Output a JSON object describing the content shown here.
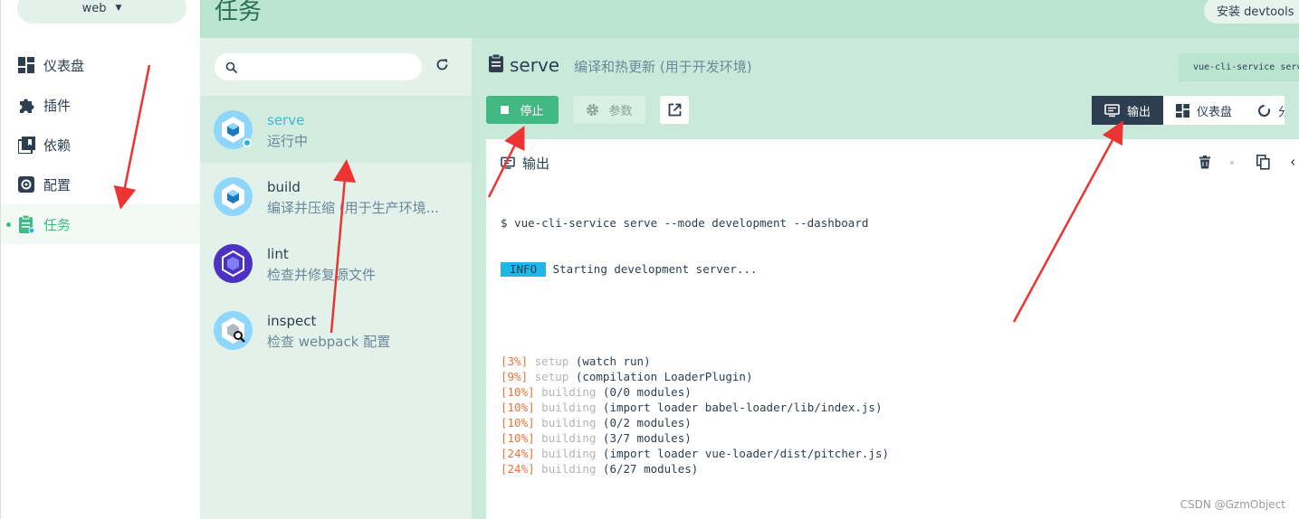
{
  "project": {
    "name": "web"
  },
  "header": {
    "title": "任务",
    "devtools_label": "安装 devtools"
  },
  "sidebar": {
    "items": [
      {
        "label": "仪表盘",
        "icon": "dashboard-icon"
      },
      {
        "label": "插件",
        "icon": "puzzle-icon"
      },
      {
        "label": "依赖",
        "icon": "dependencies-icon"
      },
      {
        "label": "配置",
        "icon": "gear-icon"
      },
      {
        "label": "任务",
        "icon": "clipboard-icon",
        "active": true
      }
    ]
  },
  "tasklist": {
    "search_placeholder": "",
    "tasks": [
      {
        "name": "serve",
        "desc": "运行中",
        "active": true,
        "running": true
      },
      {
        "name": "build",
        "desc": "编译并压缩 (用于生产环境..."
      },
      {
        "name": "lint",
        "desc": "检查并修复源文件"
      },
      {
        "name": "inspect",
        "desc": "检查 webpack 配置"
      }
    ]
  },
  "main": {
    "task_name": "serve",
    "task_desc": "编译和热更新 (用于开发环境)",
    "command": "vue-cli-service serve",
    "stop_label": "停止",
    "params_label": "参数",
    "tabs": [
      {
        "label": "输出",
        "active": true
      },
      {
        "label": "仪表盘"
      },
      {
        "label": "分析"
      }
    ],
    "output_title": "输出"
  },
  "terminal": {
    "command_line": "$ vue-cli-service serve --mode development --dashboard",
    "info_badge": "INFO",
    "info_text": " Starting development server...",
    "lines": [
      {
        "pct": "[3%]",
        "step": "setup",
        "detail": "(watch run)"
      },
      {
        "pct": "[9%]",
        "step": "setup",
        "detail": "(compilation LoaderPlugin)"
      },
      {
        "pct": "[10%]",
        "step": "building",
        "detail": "(0/0 modules)"
      },
      {
        "pct": "[10%]",
        "step": "building",
        "detail": "(import loader babel-loader/lib/index.js)"
      },
      {
        "pct": "[10%]",
        "step": "building",
        "detail": "(0/2 modules)"
      },
      {
        "pct": "[10%]",
        "step": "building",
        "detail": "(3/7 modules)"
      },
      {
        "pct": "[24%]",
        "step": "building",
        "detail": "(import loader vue-loader/dist/pitcher.js)"
      },
      {
        "pct": "[24%]",
        "step": "building",
        "detail": "(6/27 modules)"
      }
    ]
  },
  "watermark": "CSDN @GzmObject",
  "colors": {
    "accent": "#42b983",
    "dark": "#2c3e50",
    "info": "#1fb6e8",
    "annotation": "#ee3333"
  }
}
